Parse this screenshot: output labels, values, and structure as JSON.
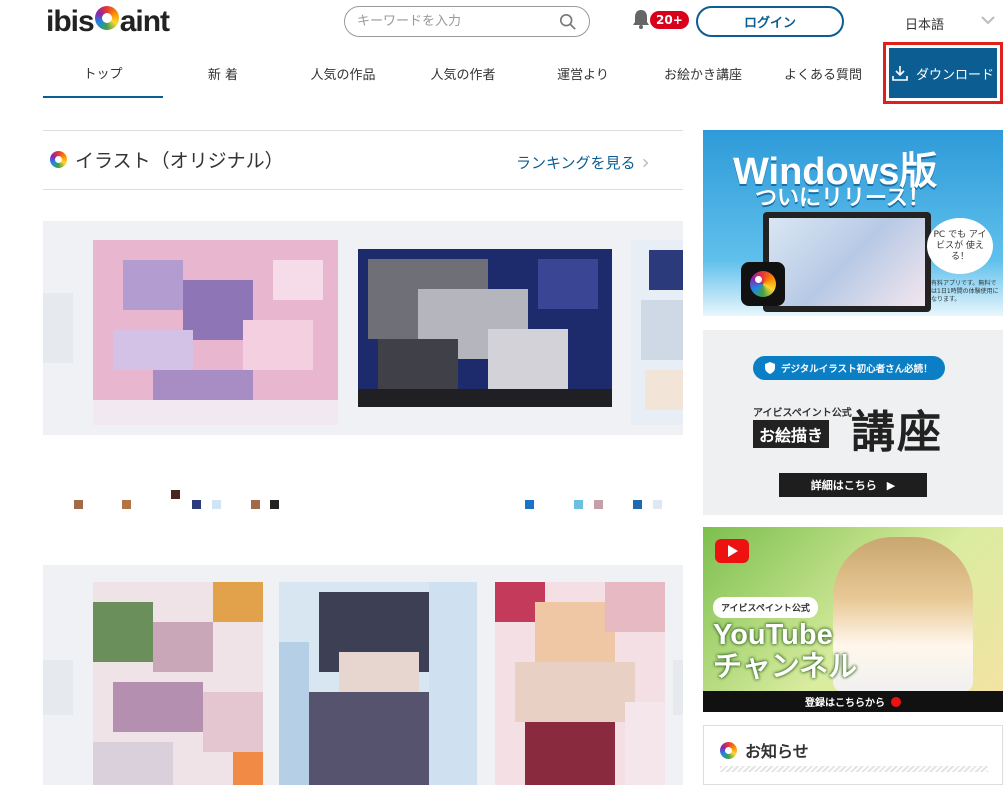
{
  "header": {
    "logo_text_left": "ibis",
    "logo_text_right": "aint",
    "search_placeholder": "キーワードを入力",
    "notification_count": "20+",
    "login_label": "ログイン",
    "language": "日本語"
  },
  "nav": {
    "items": [
      {
        "label": "トップ"
      },
      {
        "label": "新 着"
      },
      {
        "label": "人気の作品"
      },
      {
        "label": "人気の作者"
      },
      {
        "label": "運営より"
      },
      {
        "label": "お絵かき講座"
      },
      {
        "label": "よくある質問"
      }
    ],
    "download_label": "ダウンロード"
  },
  "section": {
    "title": "イラスト（オリジナル）",
    "ranking_link": "ランキングを見る"
  },
  "banners": {
    "windows": {
      "title": "Windows版",
      "subtitle": "ついにリリース！",
      "bubble": "PC でも アイビスが 使える！",
      "note": "有料アプリです。無料では1日1時間の体験使用になります。"
    },
    "course": {
      "pill": "デジタルイラスト初心者さん必読！",
      "small": "アイビスペイント公式",
      "tag": "お絵描き",
      "big": "講座",
      "button": "詳細はこちら"
    },
    "youtube": {
      "pill": "アイビスペイント公式",
      "title_line1": "YouTube",
      "title_line2": "チャンネル",
      "footer": "登録はこちらから"
    }
  },
  "news": {
    "title": "お知らせ"
  },
  "colors": {
    "accent": "#0b5d92",
    "badge": "#d8001b",
    "highlight_border": "#e0201c"
  }
}
